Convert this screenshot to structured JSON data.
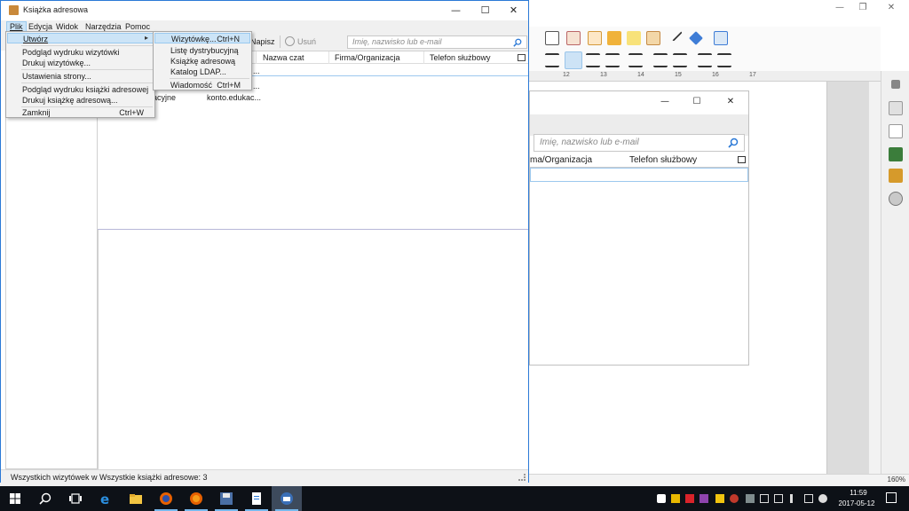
{
  "window": {
    "title": "Książka adresowa"
  },
  "menubar": {
    "items": [
      "Plik",
      "Edycja",
      "Widok",
      "Narzędzia",
      "Pomoc"
    ]
  },
  "toolbar": {
    "write_label": "Napisz",
    "delete_label": "Usuń"
  },
  "search": {
    "placeholder": "Imię, nazwisko lub e-mail"
  },
  "grid": {
    "columns": [
      "Nazwa czat",
      "Firma/Organizacja",
      "Telefon służbowy"
    ],
    "row": {
      "cell_left": "acyjne",
      "cell_email": "konto.edukac..."
    }
  },
  "plik_menu": {
    "items": [
      {
        "label": "Utwórz",
        "shortcut": "",
        "has_submenu": true,
        "highlighted": true
      },
      {
        "label": "Podgląd wydruku wizytówki",
        "shortcut": ""
      },
      {
        "label": "Drukuj wizytówkę...",
        "shortcut": ""
      },
      {
        "label": "Ustawienia strony...",
        "shortcut": ""
      },
      {
        "label": "Podgląd wydruku książki adresowej",
        "shortcut": ""
      },
      {
        "label": "Drukuj książkę adresową...",
        "shortcut": ""
      },
      {
        "label": "Zamknij",
        "shortcut": "Ctrl+W"
      }
    ]
  },
  "submenu": {
    "items": [
      {
        "label": "Wizytówkę...",
        "shortcut": "Ctrl+N",
        "highlighted": true
      },
      {
        "label": "Listę dystrybucyjną",
        "shortcut": ""
      },
      {
        "label": "Książkę adresową",
        "shortcut": ""
      },
      {
        "label": "Katalog LDAP...",
        "shortcut": ""
      },
      {
        "label": "Wiadomość",
        "shortcut": "Ctrl+M"
      }
    ]
  },
  "status": {
    "text": "Wszystkich wizytówek w Wszystkie książki adresowe: 3"
  },
  "background_dialog": {
    "search_placeholder": "Imię, nazwisko lub e-mail",
    "col1": "ma/Organizacja",
    "col2": "Telefon służbowy"
  },
  "background_app": {
    "ruler_numbers": [
      "12",
      "13",
      "14",
      "15",
      "16",
      "17"
    ],
    "zoom": "160%"
  },
  "taskbar": {
    "time": "11:59",
    "date": "2017-05-12"
  },
  "colors": {
    "accent": "#2b79d6",
    "menu_highlight": "#cce4f7",
    "taskbar": "#0d1117"
  }
}
